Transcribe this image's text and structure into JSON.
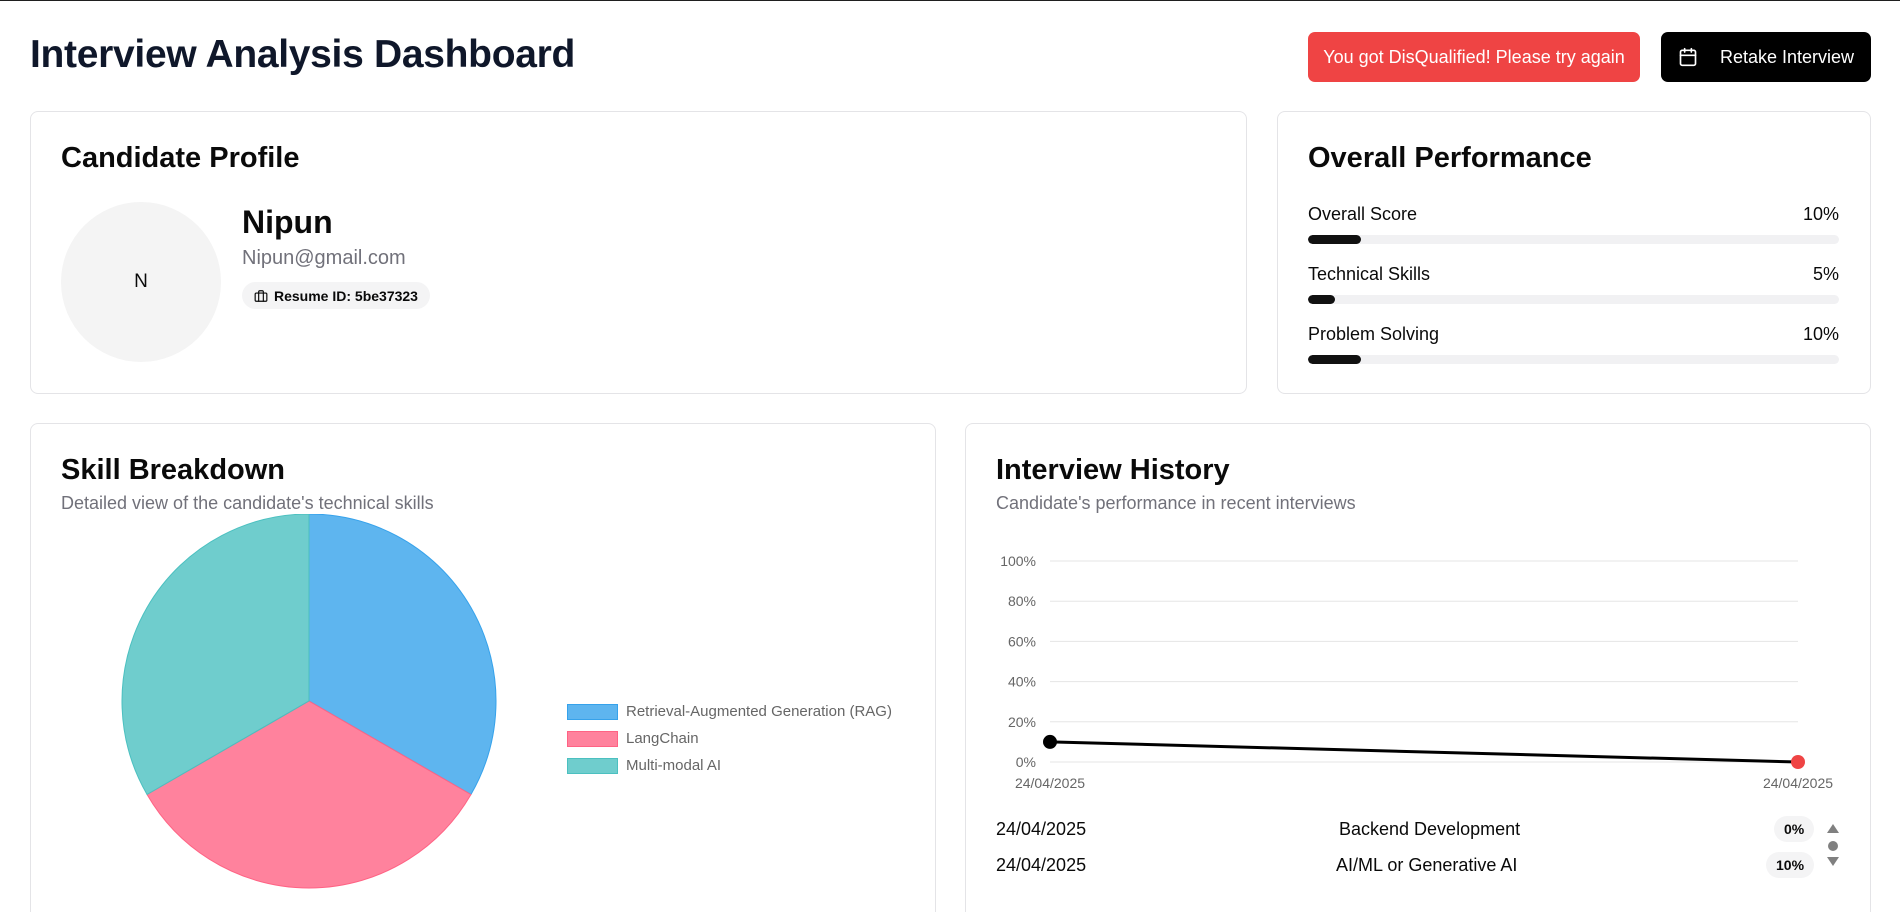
{
  "header": {
    "title": "Interview Analysis Dashboard",
    "alert_label": "You got DisQualified! Please try again",
    "retake_label": "Retake Interview"
  },
  "profile": {
    "title": "Candidate Profile",
    "initial": "N",
    "name": "Nipun",
    "email": "Nipun@gmail.com",
    "resume_label": "Resume ID: 5be37323"
  },
  "performance": {
    "title": "Overall Performance",
    "metrics": [
      {
        "label": "Overall Score",
        "value_text": "10%",
        "value": 10
      },
      {
        "label": "Technical Skills",
        "value_text": "5%",
        "value": 5
      },
      {
        "label": "Problem Solving",
        "value_text": "10%",
        "value": 10
      }
    ]
  },
  "skills": {
    "title": "Skill Breakdown",
    "subtitle": "Detailed view of the candidate's technical skills",
    "legend": [
      "Retrieval-Augmented Generation (RAG)",
      "LangChain",
      "Multi-modal AI"
    ]
  },
  "history": {
    "title": "Interview History",
    "subtitle": "Candidate's performance in recent interviews",
    "rows": [
      {
        "date": "24/04/2025",
        "category": "Backend Development",
        "score": "0%"
      },
      {
        "date": "24/04/2025",
        "category": "AI/ML or Generative AI",
        "score": "10%"
      }
    ]
  },
  "colors": {
    "alert": "#ef4444",
    "rag": "#36a2eb",
    "langchain": "#ff6384",
    "multimodal": "#4bc0c0"
  },
  "chart_data": [
    {
      "type": "pie",
      "categories": [
        "Retrieval-Augmented Generation (RAG)",
        "LangChain",
        "Multi-modal AI"
      ],
      "values": [
        1,
        1,
        1
      ],
      "legend": "right"
    },
    {
      "type": "line",
      "x": [
        "24/04/2025",
        "24/04/2025"
      ],
      "series": [
        {
          "values": [
            10,
            0
          ]
        }
      ],
      "ylim": [
        0,
        100
      ],
      "yticks": [
        "0%",
        "20%",
        "40%",
        "60%",
        "80%",
        "100%"
      ],
      "grid": true
    }
  ]
}
